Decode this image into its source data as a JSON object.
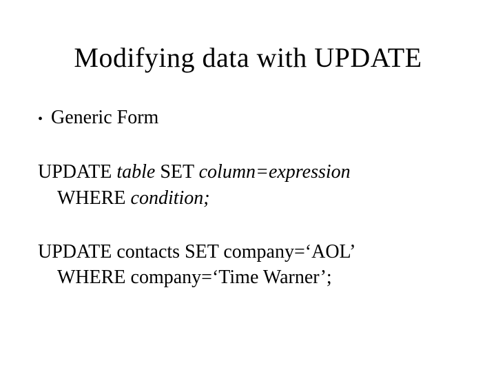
{
  "title": "Modifying data with UPDATE",
  "bullet": {
    "label": "Generic Form"
  },
  "generic": {
    "pre1": "UPDATE ",
    "table": "table",
    "mid1": " SET ",
    "colexpr": "column=expression",
    "pre2": "WHERE ",
    "cond": "condition;"
  },
  "example": {
    "line1": "UPDATE contacts SET company=‘AOL’",
    "line2": "WHERE company=‘Time Warner’;"
  }
}
